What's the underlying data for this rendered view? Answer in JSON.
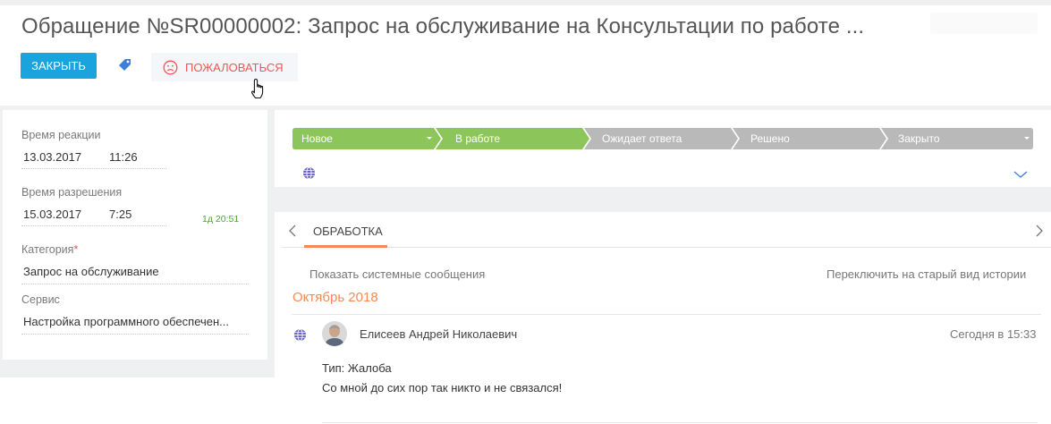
{
  "header": {
    "title": "Обращение №SR00000002: Запрос на обслуживание на Консультации по работе ...",
    "close_label": "ЗАКРЫТЬ",
    "complain_label": "ПОЖАЛОВАТЬСЯ",
    "icons": [
      "tag-icon",
      "sad-face-icon",
      "hand-cursor-icon"
    ]
  },
  "fields": {
    "reaction_label": "Время реакции",
    "reaction_date": "13.03.2017",
    "reaction_time": "11:26",
    "resolution_label": "Время разрешения",
    "resolution_date": "15.03.2017",
    "resolution_time": "7:25",
    "resolution_remaining": "1д 20:51",
    "category_label": "Категория",
    "category_required": "*",
    "category_value": "Запрос на обслуживание",
    "service_label": "Сервис",
    "service_value": "Настройка программного обеспечен..."
  },
  "stages": [
    {
      "label": "Новое",
      "state": "done"
    },
    {
      "label": "В работе",
      "state": "current"
    },
    {
      "label": "Ожидает ответа",
      "state": "pending"
    },
    {
      "label": "Решено",
      "state": "pending"
    },
    {
      "label": "Закрыто",
      "state": "pending"
    }
  ],
  "stage_colors": {
    "done": "#8cc65a",
    "pending": "#b9b9b9",
    "text": "#ffffff"
  },
  "tabs": {
    "active_label": "ОБРАБОТКА"
  },
  "feed": {
    "show_system_messages": "Показать системные сообщения",
    "switch_old_view": "Переключить на старый вид истории",
    "month": "Октябрь 2018",
    "entries": [
      {
        "author": "Елисеев Андрей Николаевич",
        "time": "Сегодня в 15:33",
        "line1": "Тип: Жалоба",
        "line2": "Со мной до сих пор так никто и не связался!"
      }
    ]
  },
  "colors": {
    "accent_blue": "#1aa3dc",
    "complain_red": "#f05555",
    "orange": "#f28b55",
    "green_time": "#49a72f"
  }
}
